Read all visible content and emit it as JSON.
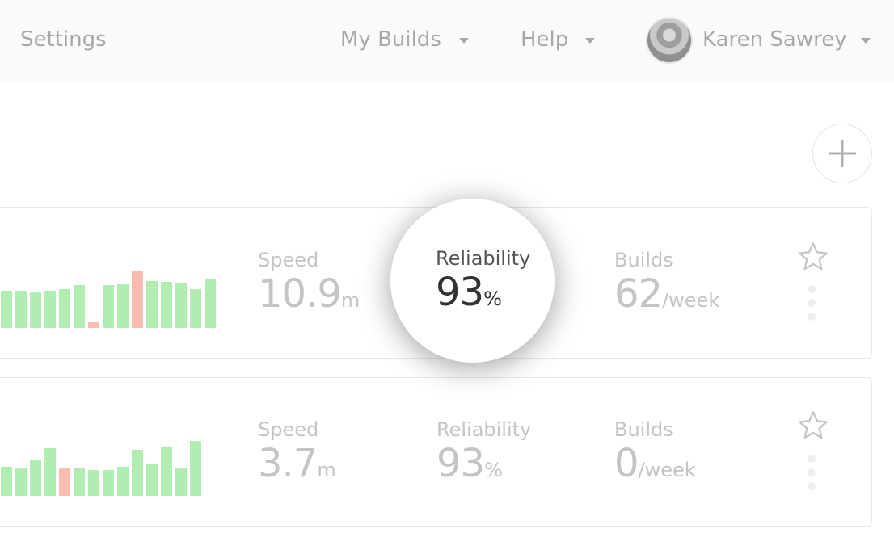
{
  "nav": {
    "settings": "Settings",
    "my_builds": "My Builds",
    "help": "Help",
    "user_name": "Karen Sawrey"
  },
  "colors": {
    "pass_bar": "#b1edb1",
    "fail_bar": "#fbbcb0",
    "muted_text": "#c4c4c4"
  },
  "cards": [
    {
      "history": [
        {
          "level": 0.65,
          "status": "pass"
        },
        {
          "level": 0.66,
          "status": "pass"
        },
        {
          "level": 0.63,
          "status": "pass"
        },
        {
          "level": 0.65,
          "status": "pass"
        },
        {
          "level": 0.68,
          "status": "pass"
        },
        {
          "level": 0.76,
          "status": "pass"
        },
        {
          "level": 0.1,
          "status": "fail"
        },
        {
          "level": 0.76,
          "status": "pass"
        },
        {
          "level": 0.77,
          "status": "pass"
        },
        {
          "level": 1.0,
          "status": "fail"
        },
        {
          "level": 0.83,
          "status": "pass"
        },
        {
          "level": 0.81,
          "status": "pass"
        },
        {
          "level": 0.8,
          "status": "pass"
        },
        {
          "level": 0.69,
          "status": "pass"
        },
        {
          "level": 0.87,
          "status": "pass"
        }
      ],
      "speed": {
        "label": "Speed",
        "value": "10.9",
        "unit": "m"
      },
      "reliability": {
        "label": "Reliability",
        "value": "93",
        "unit": "%"
      },
      "builds": {
        "label": "Builds",
        "value": "62",
        "unit": "/week"
      }
    },
    {
      "history": [
        {
          "level": 0.53,
          "status": "pass"
        },
        {
          "level": 0.52,
          "status": "pass"
        },
        {
          "level": 0.65,
          "status": "pass"
        },
        {
          "level": 0.87,
          "status": "pass"
        },
        {
          "level": 0.5,
          "status": "fail"
        },
        {
          "level": 0.5,
          "status": "pass"
        },
        {
          "level": 0.47,
          "status": "pass"
        },
        {
          "level": 0.47,
          "status": "pass"
        },
        {
          "level": 0.53,
          "status": "pass"
        },
        {
          "level": 0.84,
          "status": "pass"
        },
        {
          "level": 0.59,
          "status": "pass"
        },
        {
          "level": 0.88,
          "status": "pass"
        },
        {
          "level": 0.52,
          "status": "pass"
        },
        {
          "level": 1.0,
          "status": "pass"
        }
      ],
      "speed": {
        "label": "Speed",
        "value": "3.7",
        "unit": "m"
      },
      "reliability": {
        "label": "Reliability",
        "value": "93",
        "unit": "%"
      },
      "builds": {
        "label": "Builds",
        "value": "0",
        "unit": "/week"
      }
    }
  ]
}
